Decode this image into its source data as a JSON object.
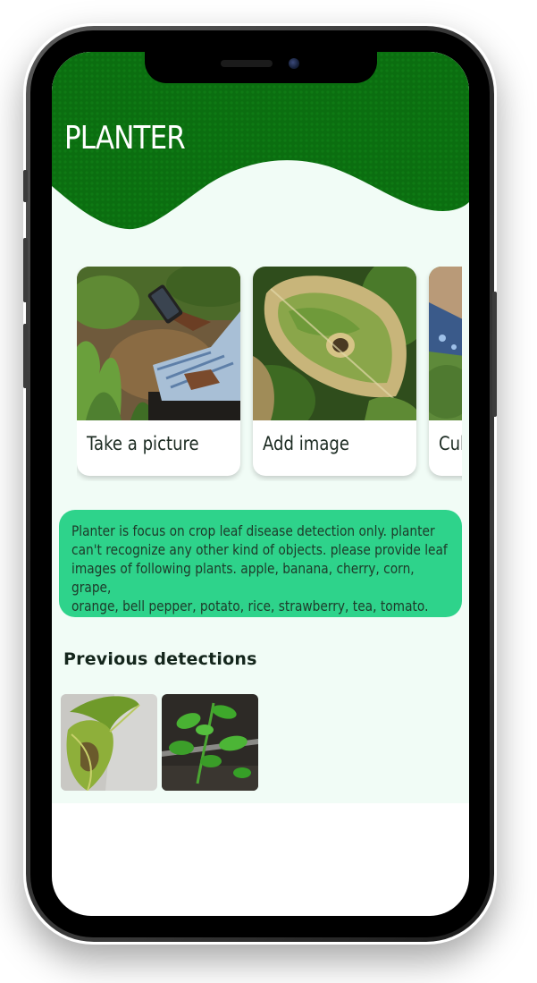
{
  "app": {
    "title": "PLANTER",
    "brand_color": "#0b6e10",
    "accent_color": "#2ed38b",
    "background_color": "#f1fcf6"
  },
  "actions": [
    {
      "label": "Take a picture",
      "icon": "camera-photo"
    },
    {
      "label": "Add image",
      "icon": "gallery-photo"
    },
    {
      "label": "Cul",
      "icon": "cultivation-photo"
    }
  ],
  "info": {
    "lines": [
      "Planter is focus on crop leaf disease detection only. planter",
      "can't recognize any other kind of objects. please provide leaf",
      "images of following plants. apple, banana, cherry, corn, grape,",
      "orange, bell pepper, potato, rice, strawberry, tea, tomato."
    ]
  },
  "history": {
    "title": "Previous detections",
    "items": [
      {
        "image": "diseased-leaf-photo"
      },
      {
        "image": "tomato-seedling-photo"
      }
    ]
  }
}
